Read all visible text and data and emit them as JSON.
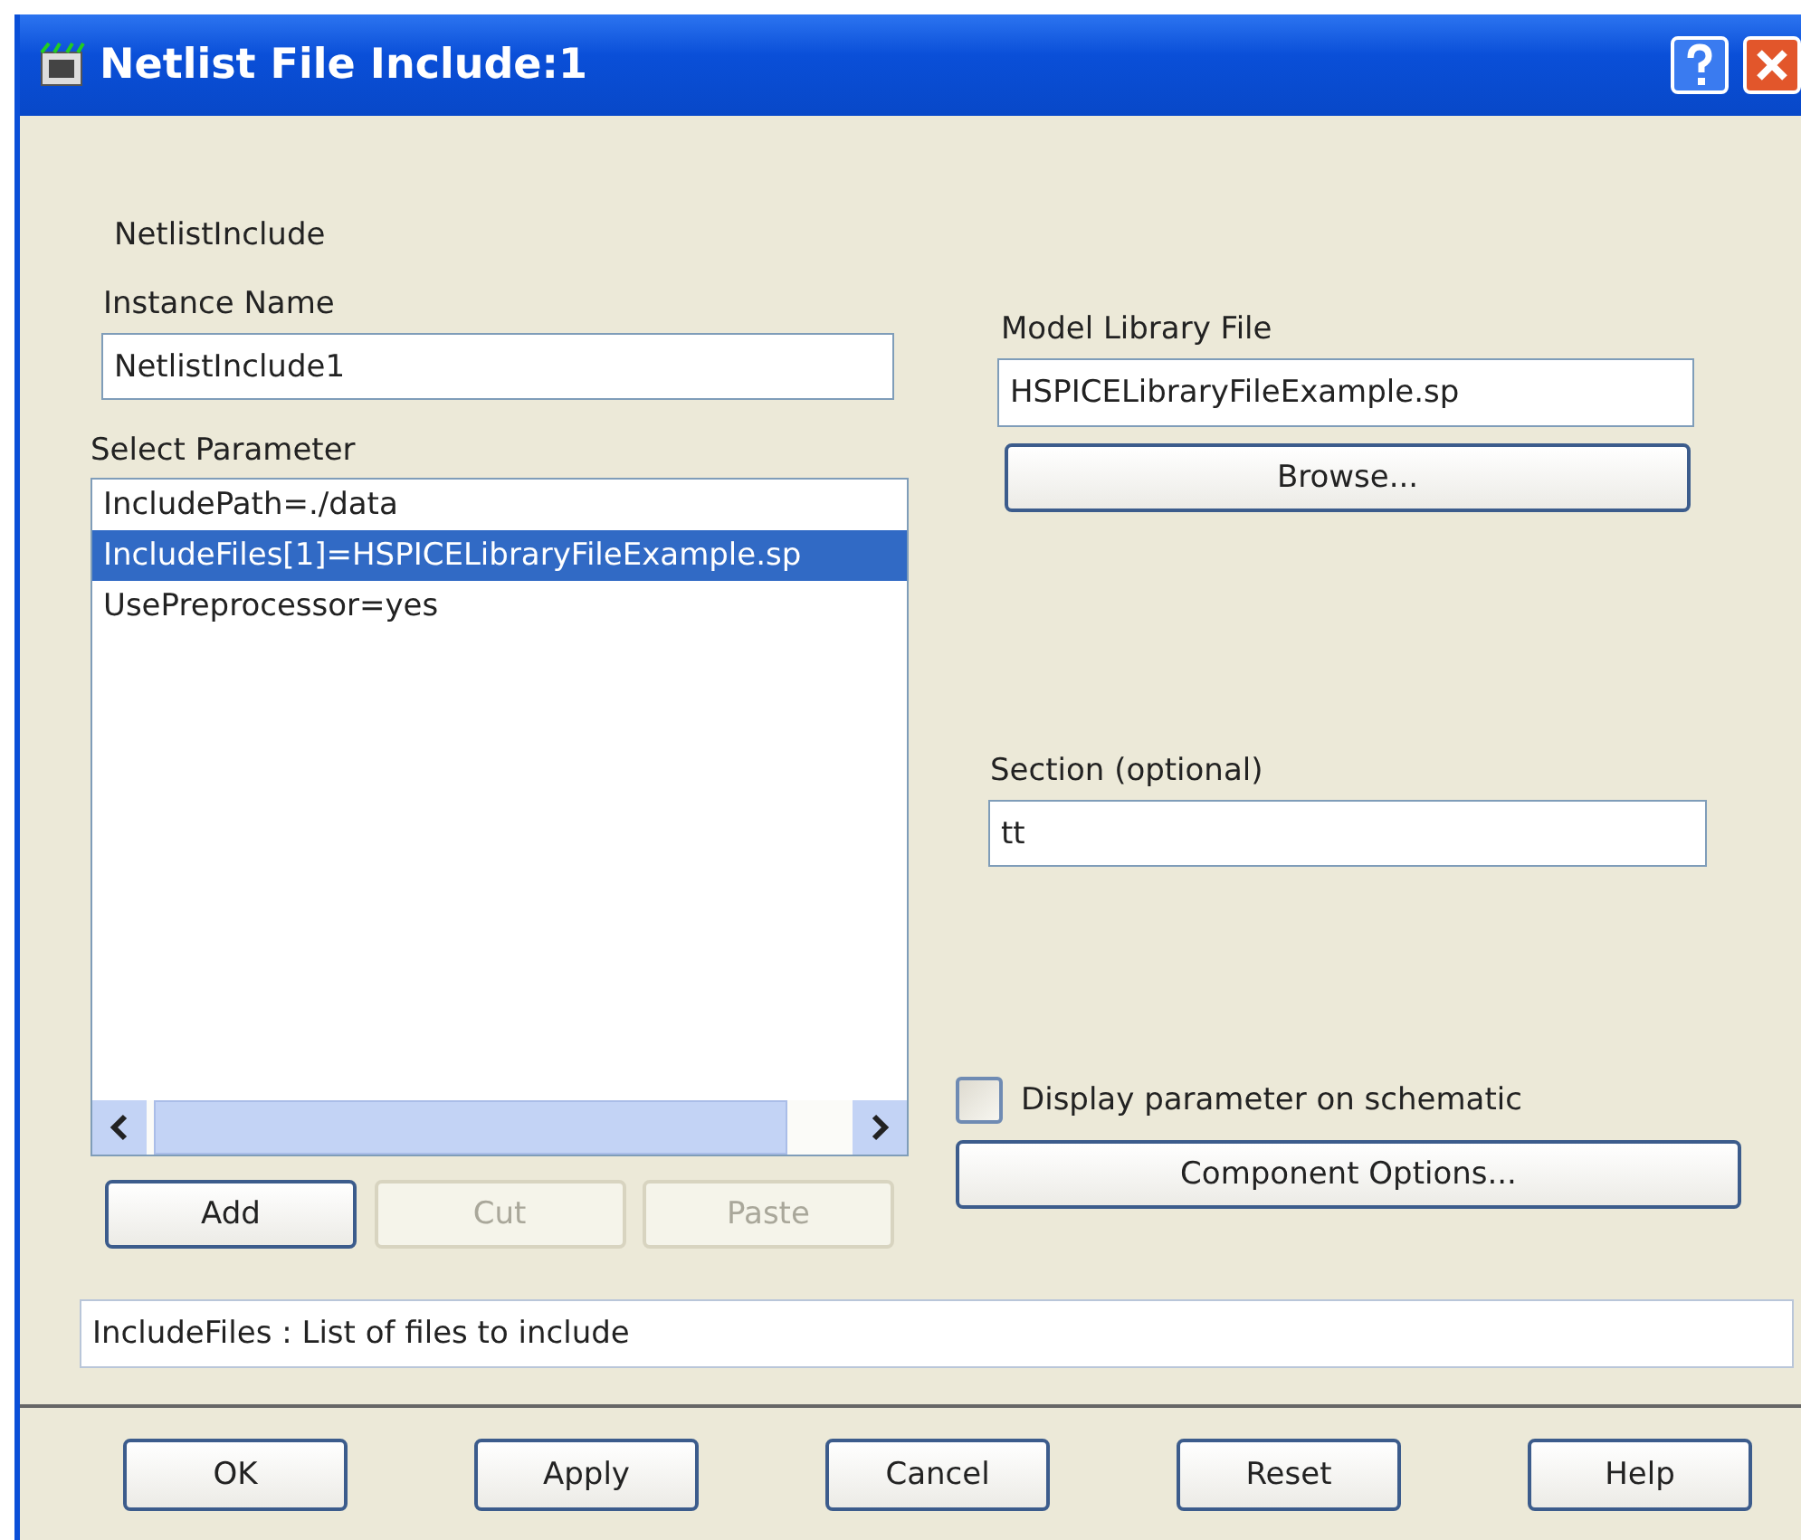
{
  "window": {
    "title": "Netlist File Include:1"
  },
  "component_label": "NetlistInclude",
  "instance_name": {
    "label": "Instance Name",
    "value": "NetlistInclude1"
  },
  "select_parameter": {
    "label": "Select Parameter",
    "items": [
      {
        "text": "IncludePath=./data",
        "selected": false
      },
      {
        "text": "IncludeFiles[1]=HSPICELibraryFileExample.sp",
        "selected": true
      },
      {
        "text": "UsePreprocessor=yes",
        "selected": false
      }
    ]
  },
  "list_buttons": [
    {
      "label": "Add",
      "disabled": false
    },
    {
      "label": "Cut",
      "disabled": true
    },
    {
      "label": "Paste",
      "disabled": true
    }
  ],
  "model_library_file": {
    "label": "Model Library File",
    "value": "HSPICELibraryFileExample.sp",
    "browse": "Browse..."
  },
  "section": {
    "label": "Section (optional)",
    "value": "tt"
  },
  "display_on_schematic": {
    "label": "Display parameter on schematic",
    "checked": false
  },
  "component_options": "Component Options...",
  "status": "IncludeFiles : List of files to include",
  "buttons": [
    "OK",
    "Apply",
    "Cancel",
    "Reset",
    "Help"
  ]
}
